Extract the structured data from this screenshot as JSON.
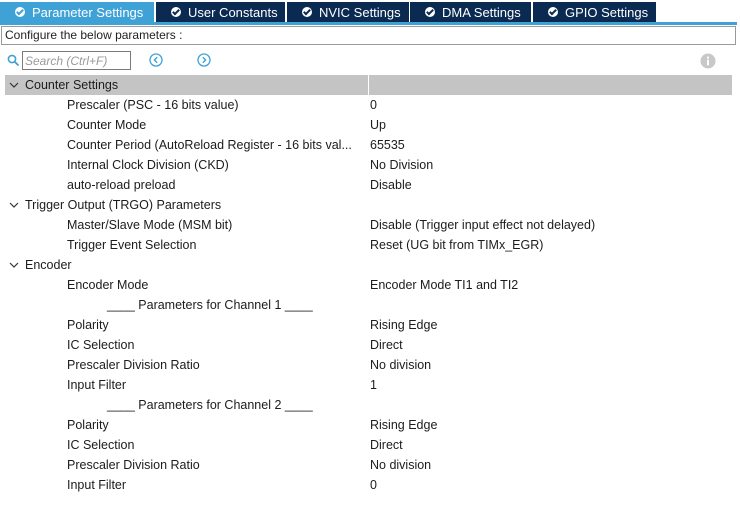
{
  "tabs": [
    {
      "label": "Parameter Settings",
      "active": true
    },
    {
      "label": "User Constants",
      "active": false
    },
    {
      "label": "NVIC Settings",
      "active": false
    },
    {
      "label": "DMA Settings",
      "active": false
    },
    {
      "label": "GPIO Settings",
      "active": false
    }
  ],
  "config_text": "Configure the below parameters :",
  "search": {
    "placeholder": "Search (Ctrl+F)",
    "value": ""
  },
  "colors": {
    "active_tab": "#3ea2d6",
    "inactive_tab": "#0b2a52",
    "group_header": "#c4c4c4",
    "nav_icon": "#3ea2d6"
  },
  "icons": {
    "search": "search-icon",
    "prev": "chevron-left-circle-icon",
    "next": "chevron-right-circle-icon",
    "info": "info-icon",
    "group": "chevron-down-icon",
    "tab": "check-circle-icon"
  },
  "groups": {
    "counter": {
      "title": "Counter Settings",
      "rows": [
        {
          "label": "Prescaler (PSC - 16 bits value)",
          "value": "0"
        },
        {
          "label": "Counter Mode",
          "value": "Up"
        },
        {
          "label": "Counter Period (AutoReload Register - 16 bits val...",
          "value": "65535"
        },
        {
          "label": "Internal Clock Division (CKD)",
          "value": "No Division"
        },
        {
          "label": "auto-reload preload",
          "value": "Disable"
        }
      ]
    },
    "trgo": {
      "title": "Trigger Output (TRGO) Parameters",
      "rows": [
        {
          "label": "Master/Slave Mode (MSM bit)",
          "value": "Disable (Trigger input effect not delayed)"
        },
        {
          "label": "Trigger Event Selection",
          "value": "Reset (UG bit from TIMx_EGR)"
        }
      ]
    },
    "encoder": {
      "title": "Encoder",
      "mode": {
        "label": "Encoder Mode",
        "value": "Encoder Mode TI1 and TI2"
      },
      "ch1_title": "____ Parameters for Channel 1 ____",
      "ch1": [
        {
          "label": "Polarity",
          "value": "Rising Edge"
        },
        {
          "label": "IC Selection",
          "value": "Direct"
        },
        {
          "label": "Prescaler Division Ratio",
          "value": "No division"
        },
        {
          "label": "Input Filter",
          "value": "1"
        }
      ],
      "ch2_title": "____ Parameters for Channel 2 ____",
      "ch2": [
        {
          "label": "Polarity",
          "value": "Rising Edge"
        },
        {
          "label": "IC Selection",
          "value": "Direct"
        },
        {
          "label": "Prescaler Division Ratio",
          "value": "No division"
        },
        {
          "label": "Input Filter",
          "value": "0"
        }
      ]
    }
  }
}
